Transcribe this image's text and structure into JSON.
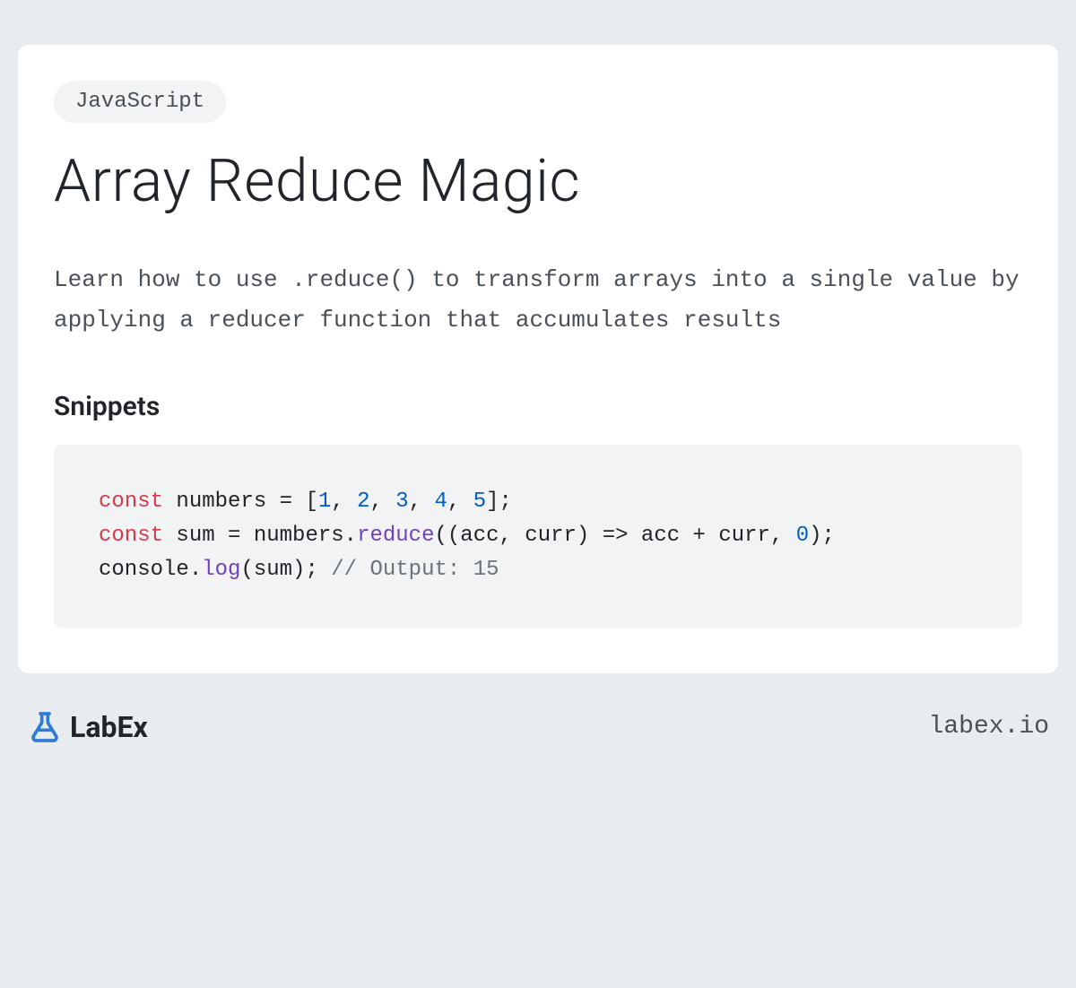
{
  "tag": "JavaScript",
  "title": "Array Reduce Magic",
  "description": "Learn how to use .reduce() to transform arrays into a single value by applying a reducer function that accumulates results",
  "section_heading": "Snippets",
  "logo_text": "LabEx",
  "footer_url": "labex.io",
  "code": {
    "line1_keyword": "const",
    "line1_var": " numbers = [",
    "line1_n1": "1",
    "line1_c1": ", ",
    "line1_n2": "2",
    "line1_c2": ", ",
    "line1_n3": "3",
    "line1_c3": ", ",
    "line1_n4": "4",
    "line1_c4": ", ",
    "line1_n5": "5",
    "line1_end": "];",
    "line2_keyword": "const",
    "line2_part1": " sum = numbers.",
    "line2_method": "reduce",
    "line2_part2": "((acc, curr) => acc + curr, ",
    "line2_n": "0",
    "line2_end": ");",
    "line3_part1": "console.",
    "line3_method": "log",
    "line3_part2": "(sum); ",
    "line3_comment": "// Output: 15"
  }
}
